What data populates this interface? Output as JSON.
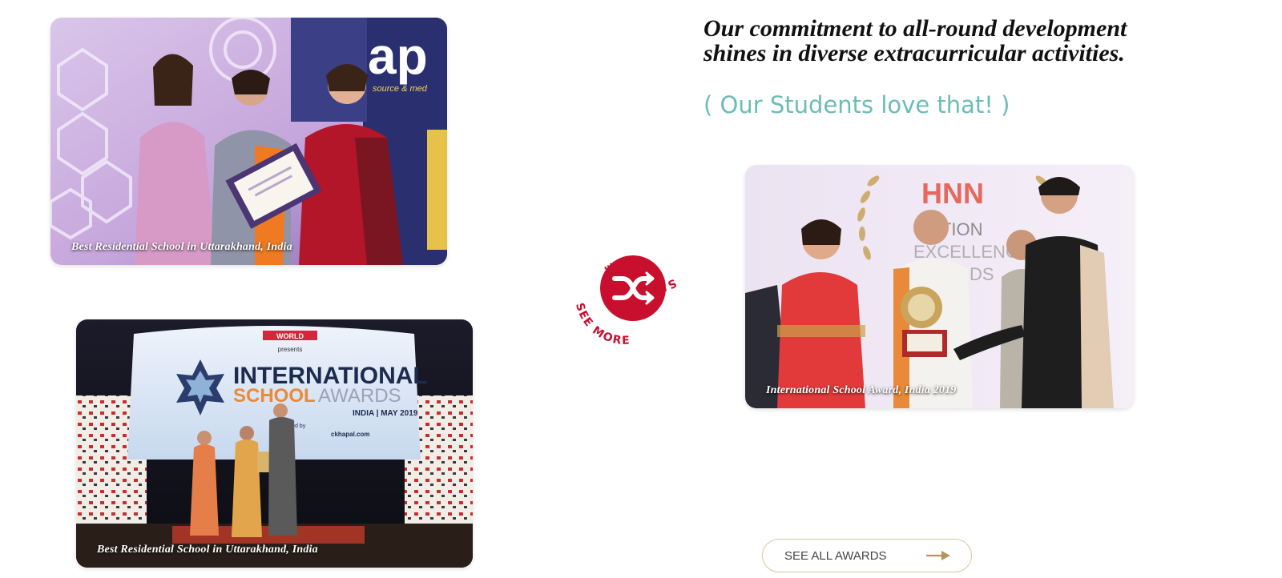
{
  "headline": {
    "line1": "Our commitment to all-round development",
    "line2": "shines in diverse extracurricular activities."
  },
  "subheadline": "( Our Students love that! )",
  "awards": [
    {
      "caption": "Best Residential School in Uttarakhand, India",
      "backdrop_text": "ap",
      "backdrop_subtext": "source & med"
    },
    {
      "caption": "Best Residential School in Uttarakhand, India",
      "screen": {
        "presenter_line1": "WORLD",
        "presenter_line2": "presents",
        "title_line1": "INTERNATIONAL",
        "title_line2a": "SCHOOL",
        "title_line2b": "AWARDS",
        "meta": "INDIA | MAY 2019",
        "powered_by": "powered by",
        "sponsor": "ckhapal.com"
      }
    },
    {
      "caption": "International School Award, India 2019",
      "backdrop": {
        "logo": "HNN",
        "line1": "CATION",
        "line2": "EXCELLENC",
        "line3": "DS"
      }
    }
  ],
  "see_more_badge": {
    "label": "SEE MORE",
    "icon": "shuffle-icon"
  },
  "cta": {
    "label": "SEE ALL AWARDS",
    "icon": "arrow-right-icon"
  },
  "colors": {
    "accent_red": "#c8102e",
    "teal": "#6cbcb7",
    "gold_border": "#d8c79a",
    "gold_arrow": "#b8945a"
  }
}
